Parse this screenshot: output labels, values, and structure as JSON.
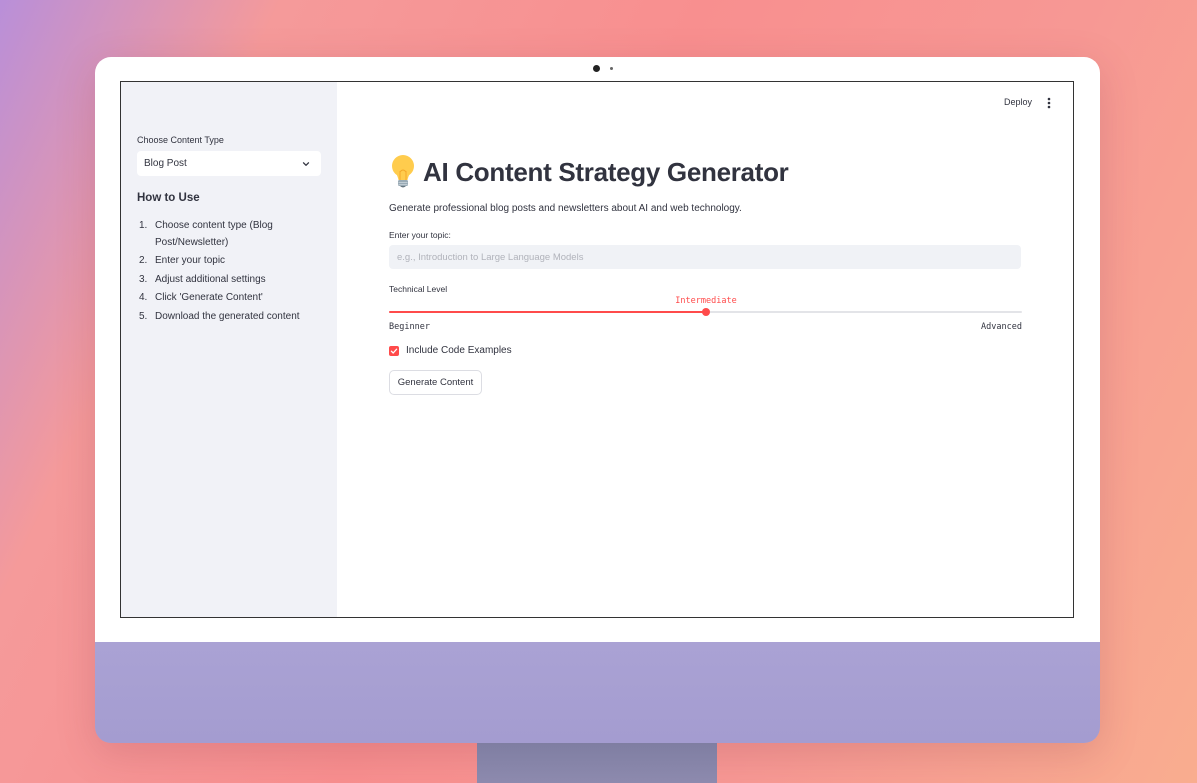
{
  "sidebar": {
    "content_type_label": "Choose Content Type",
    "content_type_value": "Blog Post",
    "how_to_title": "How to Use",
    "steps": [
      {
        "num": "1.",
        "text": "Choose content type (Blog Post/Newsletter)"
      },
      {
        "num": "2.",
        "text": "Enter your topic"
      },
      {
        "num": "3.",
        "text": "Adjust additional settings"
      },
      {
        "num": "4.",
        "text": "Click 'Generate Content'"
      },
      {
        "num": "5.",
        "text": "Download the generated content"
      }
    ]
  },
  "header": {
    "deploy_label": "Deploy",
    "menu_icon": "more-vertical-icon"
  },
  "main": {
    "title_icon": "lightbulb-icon",
    "title": "AI Content Strategy Generator",
    "subtitle": "Generate professional blog posts and newsletters about AI and web technology.",
    "topic_label": "Enter your topic:",
    "topic_placeholder": "e.g., Introduction to Large Language Models",
    "topic_value": "",
    "slider": {
      "label": "Technical Level",
      "options": [
        "Beginner",
        "Intermediate",
        "Advanced"
      ],
      "selected": "Intermediate",
      "position_fraction": 0.5,
      "min_label": "Beginner",
      "max_label": "Advanced"
    },
    "checkbox": {
      "label": "Include Code Examples",
      "checked": true
    },
    "generate_button": "Generate Content"
  },
  "colors": {
    "accent": "#ff4b4b",
    "text": "#31333f",
    "sidebar_bg": "#f1f2f7",
    "input_bg": "#f0f2f6"
  }
}
